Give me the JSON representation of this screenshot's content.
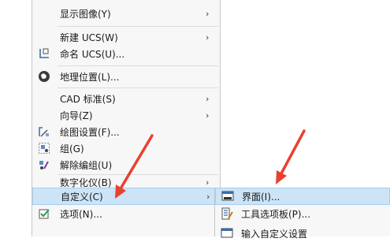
{
  "main_menu": {
    "items": [
      {
        "label": "显示图像(Y)",
        "icon": "",
        "has_submenu": true
      },
      {
        "label": "新建 UCS(W)",
        "icon": "",
        "has_submenu": true
      },
      {
        "label": "命名 UCS(U)...",
        "icon": "named-ucs-icon",
        "has_submenu": false
      },
      {
        "label": "地理位置(L)...",
        "icon": "geolocation-icon",
        "has_submenu": false
      },
      {
        "label": "CAD 标准(S)",
        "icon": "",
        "has_submenu": true
      },
      {
        "label": "向导(Z)",
        "icon": "",
        "has_submenu": true
      },
      {
        "label": "绘图设置(F)...",
        "icon": "drafting-settings-icon",
        "has_submenu": false
      },
      {
        "label": "组(G)",
        "icon": "group-icon",
        "has_submenu": false
      },
      {
        "label": "解除编组(U)",
        "icon": "ungroup-icon",
        "has_submenu": false
      },
      {
        "label": "数字化仪(B)",
        "icon": "",
        "has_submenu": true
      },
      {
        "label": "自定义(C)",
        "icon": "",
        "has_submenu": true,
        "highlighted": true
      },
      {
        "label": "选项(N)...",
        "icon": "options-icon",
        "has_submenu": false
      }
    ]
  },
  "submenu": {
    "items": [
      {
        "label": "界面(I)...",
        "icon": "cui-interface-icon",
        "highlighted": true
      },
      {
        "label": "工具选项板(P)...",
        "icon": "tool-palettes-icon"
      },
      {
        "label": "输入自定义设置",
        "icon": "import-customizations-icon"
      }
    ]
  },
  "arrow_symbol": "›",
  "colors": {
    "highlight": "#cce4f7",
    "highlight_border": "#a6cfee",
    "annotation_arrow": "#e8412f"
  }
}
